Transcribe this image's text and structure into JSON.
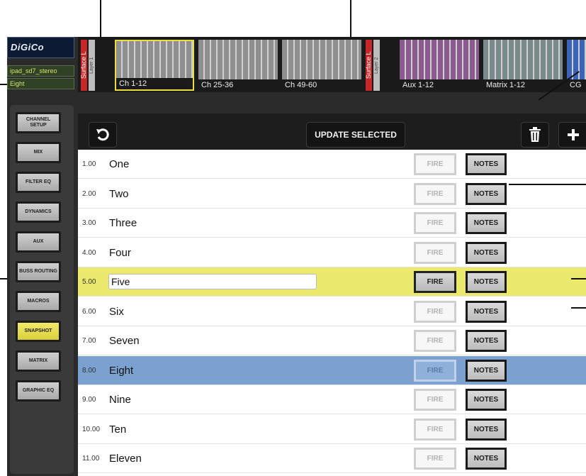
{
  "header": {
    "logo_text": "DiGiCo",
    "session_name": "ipad_sd7_stereo",
    "current_snapshot": "Eight"
  },
  "strip": {
    "surface_left_1": "Surface L",
    "layer_1": "Layer 1",
    "surface_left_2": "Surface L",
    "layer_2": "Layer 2",
    "banks": [
      {
        "label": "Ch 1-12",
        "color": "#8f8f8f",
        "selected": true
      },
      {
        "label": "Ch 25-36",
        "color": "#8f8f8f",
        "selected": false
      },
      {
        "label": "Ch 49-60",
        "color": "#8f8f8f",
        "selected": false
      },
      {
        "label": "Aux 1-12",
        "color": "#8a5a8e",
        "selected": false
      },
      {
        "label": "Matrix 1-12",
        "color": "#7a8a8a",
        "selected": false
      },
      {
        "label": "CG",
        "color": "#3b63b8",
        "selected": false
      }
    ]
  },
  "sidebar": {
    "items": [
      {
        "label": "CHANNEL SETUP",
        "active": false
      },
      {
        "label": "MIX",
        "active": false
      },
      {
        "label": "FILTER EQ",
        "active": false
      },
      {
        "label": "DYNAMICS",
        "active": false
      },
      {
        "label": "AUX",
        "active": false
      },
      {
        "label": "BUSS ROUTING",
        "active": false
      },
      {
        "label": "MACROS",
        "active": false
      },
      {
        "label": "SNAPSHOT",
        "active": true
      },
      {
        "label": "MATRIX",
        "active": false
      },
      {
        "label": "GRAPHIC EQ",
        "active": false
      }
    ]
  },
  "toolbar": {
    "undo_icon": "undo-icon",
    "update_label": "UPDATE SELECTED",
    "delete_icon": "trash-icon",
    "add_icon": "plus-icon"
  },
  "snapshots": {
    "fire_label": "FIRE",
    "notes_label": "NOTES",
    "rows": [
      {
        "number": "1.00",
        "name": "One"
      },
      {
        "number": "2.00",
        "name": "Two"
      },
      {
        "number": "3.00",
        "name": "Three"
      },
      {
        "number": "4.00",
        "name": "Four"
      },
      {
        "number": "5.00",
        "name": "Five"
      },
      {
        "number": "6.00",
        "name": "Six"
      },
      {
        "number": "7.00",
        "name": "Seven"
      },
      {
        "number": "8.00",
        "name": "Eight"
      },
      {
        "number": "9.00",
        "name": "Nine"
      },
      {
        "number": "10.00",
        "name": "Ten"
      },
      {
        "number": "11.00",
        "name": "Eleven"
      }
    ]
  },
  "colors": {
    "accent_yellow": "#eae96c",
    "selected_blue": "#7aa1cf",
    "surface_red": "#c8272a"
  }
}
